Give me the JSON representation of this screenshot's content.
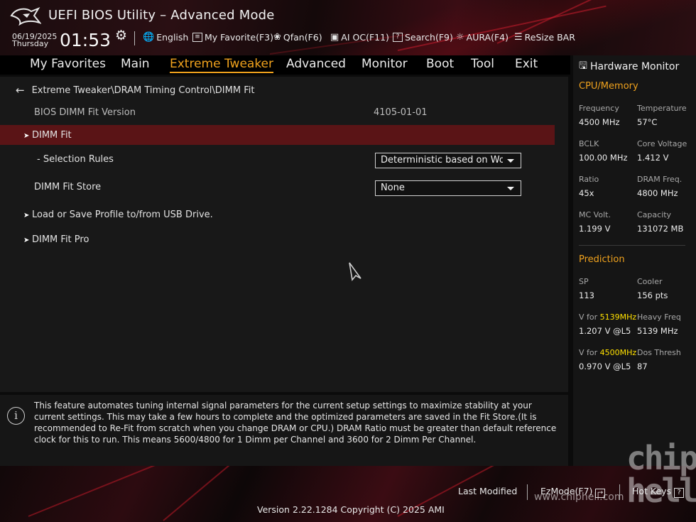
{
  "app": {
    "title": "UEFI BIOS Utility – Advanced Mode"
  },
  "clock": {
    "date": "06/19/2025",
    "day": "Thursday",
    "time": "01:53"
  },
  "toolbar": {
    "language": "English",
    "my_favorite": "My Favorite(F3)",
    "qfan": "Qfan(F6)",
    "ai_oc": "AI OC(F11)",
    "search": "Search(F9)",
    "aura": "AURA(F4)",
    "resize_bar": "ReSize BAR"
  },
  "nav": {
    "tabs": [
      {
        "label": "My Favorites"
      },
      {
        "label": "Main"
      },
      {
        "label": "Extreme Tweaker"
      },
      {
        "label": "Advanced"
      },
      {
        "label": "Monitor"
      },
      {
        "label": "Boot"
      },
      {
        "label": "Tool"
      },
      {
        "label": "Exit"
      }
    ],
    "active": "Extreme Tweaker"
  },
  "page": {
    "breadcrumb": "Extreme Tweaker\\DRAM Timing Control\\DIMM Fit",
    "bios_version_label": "BIOS DIMM Fit Version",
    "bios_version_value": "4105-01-01",
    "dimm_fit": "DIMM Fit",
    "selection_rules_label": "- Selection Rules",
    "selection_rules_value": "Deterministic based on Wo",
    "dimm_fit_store_label": "DIMM Fit Store",
    "dimm_fit_store_value": "None",
    "load_save_profile": "Load or Save Profile to/from USB Drive.",
    "dimm_fit_pro": "DIMM Fit Pro"
  },
  "help": {
    "text": "This feature automates tuning internal signal parameters for the current setup settings to maximize stability at your current settings. This may take a few hours to complete and the optimized parameters are saved in the Fit Store.(It is recommended to Re-Fit from scratch when you change DRAM or CPU.) DRAM Ratio must be greater than default reference clock for this to run. This means 5600/4800 for 1 Dimm per Channel and 3600 for 2 Dimm Per Channel."
  },
  "hw_monitor": {
    "title": "Hardware Monitor",
    "cpu_memory": {
      "title": "CPU/Memory",
      "frequency_label": "Frequency",
      "frequency": "4500 MHz",
      "temperature_label": "Temperature",
      "temperature": "57°C",
      "bclk_label": "BCLK",
      "bclk": "100.00 MHz",
      "core_voltage_label": "Core Voltage",
      "core_voltage": "1.412 V",
      "ratio_label": "Ratio",
      "ratio": "45x",
      "dram_freq_label": "DRAM Freq.",
      "dram_freq": "4800 MHz",
      "mc_volt_label": "MC Volt.",
      "mc_volt": "1.199 V",
      "capacity_label": "Capacity",
      "capacity": "131072 MB"
    },
    "prediction": {
      "title": "Prediction",
      "sp_label": "SP",
      "sp": "113",
      "cooler_label": "Cooler",
      "cooler": "156 pts",
      "v_for_prefix": "V for ",
      "v_for_1_freq": "5139MHz",
      "v_for_1": "1.207 V @L5",
      "heavy_freq_label": "Heavy Freq",
      "heavy_freq": "5139 MHz",
      "v_for_2_freq": "4500MHz",
      "v_for_2": "0.970 V @L5",
      "dos_thresh_label": "Dos Thresh",
      "dos_thresh": "87"
    }
  },
  "footer": {
    "last_modified": "Last Modified",
    "ezmode": "EzMode(F7)",
    "hot_keys": "Hot Keys",
    "hot_keys_key": "?",
    "version": "Version 2.22.1284 Copyright (C) 2025 AMI"
  },
  "watermark": {
    "logo_text": "chip hell",
    "url": "www.chiphell.com"
  },
  "colors": {
    "accent": "#f0a21d",
    "highlight_row": "#5a1416",
    "prediction_freq": "#ffe000"
  }
}
